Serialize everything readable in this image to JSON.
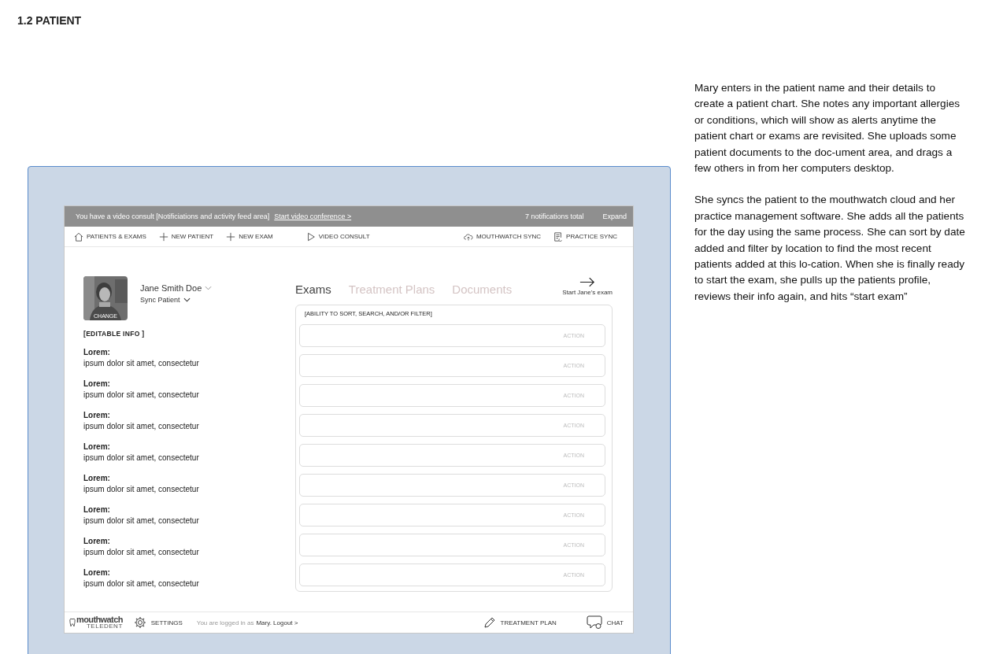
{
  "page_title": "1.2 PATIENT",
  "notification_bar": {
    "message": "You have a video consult [Notificiations and activity feed area]",
    "link": "Start video conference >",
    "count": "7 notifications total",
    "expand": "Expand"
  },
  "nav": {
    "left": [
      {
        "kind": "home",
        "label": "PATIENTS & EXAMS"
      },
      {
        "kind": "plus",
        "label": "NEW PATIENT"
      },
      {
        "kind": "plus",
        "label": "NEW EXAM"
      },
      {
        "kind": "play",
        "label": "VIDEO CONSULT"
      }
    ],
    "right": [
      {
        "kind": "cloud",
        "label": "MOUTHWATCH SYNC"
      },
      {
        "kind": "doc",
        "label": "PRACTICE SYNC"
      }
    ]
  },
  "patient": {
    "photo": {
      "kind": "picture",
      "caption": "CHANGE"
    },
    "name": "Jane Smith Doe",
    "sync": "Sync Patient",
    "editable_label": "[EDITABLE INFO ]",
    "fields": [
      {
        "label": "Lorem:",
        "value": "ipsum dolor sit amet, consectetur"
      },
      {
        "label": "Lorem:",
        "value": "ipsum dolor sit amet, consectetur"
      },
      {
        "label": "Lorem:",
        "value": "ipsum dolor sit amet, consectetur"
      },
      {
        "label": "Lorem:",
        "value": "ipsum dolor sit amet, consectetur"
      },
      {
        "label": "Lorem:",
        "value": "ipsum dolor sit amet, consectetur"
      },
      {
        "label": "Lorem:",
        "value": "ipsum dolor sit amet, consectetur"
      },
      {
        "label": "Lorem:",
        "value": "ipsum dolor sit amet, consectetur"
      },
      {
        "label": "Lorem:",
        "value": "ipsum dolor sit amet, consectetur"
      }
    ]
  },
  "tabs": [
    {
      "label": "Exams",
      "selected": true
    },
    {
      "label": "Treatment Plans",
      "selected": false
    },
    {
      "label": "Documents",
      "selected": false
    }
  ],
  "start_exam": "Start Jane's exam",
  "exam_list": {
    "header": "[ABILITY TO SORT, SEARCH, AND/OR FILTER]",
    "rows": [
      {
        "action": "ACTION"
      },
      {
        "action": "ACTION"
      },
      {
        "action": "ACTION"
      },
      {
        "action": "ACTION"
      },
      {
        "action": "ACTION"
      },
      {
        "action": "ACTION"
      },
      {
        "action": "ACTION"
      },
      {
        "action": "ACTION"
      },
      {
        "action": "ACTION"
      }
    ]
  },
  "footer": {
    "logo": "mouthwatch",
    "logo_sub": "TELEDENT",
    "settings": "SETTINGS",
    "login_prefix": "You are logged in as",
    "login_user": "Mary. Logout >",
    "treatment_plan": "TREATMENT PLAN",
    "chat": "CHAT"
  },
  "description": [
    "Mary enters in the patient name and their details to create a patient chart. She notes any important allergies or conditions, which will show as alerts anytime the patient chart or exams are revisited. She uploads some patient documents to the doc-ument area, and drags a few others in from her computers desktop.",
    "She syncs the patient to the mouthwatch cloud and her practice management software. She adds all the patients for the day using the same process. She can sort by date added and filter by location to find the most recent patients added at this lo-cation. When she is finally ready to start the exam, she pulls up the patients profile, reviews their info again, and hits “start exam”"
  ]
}
